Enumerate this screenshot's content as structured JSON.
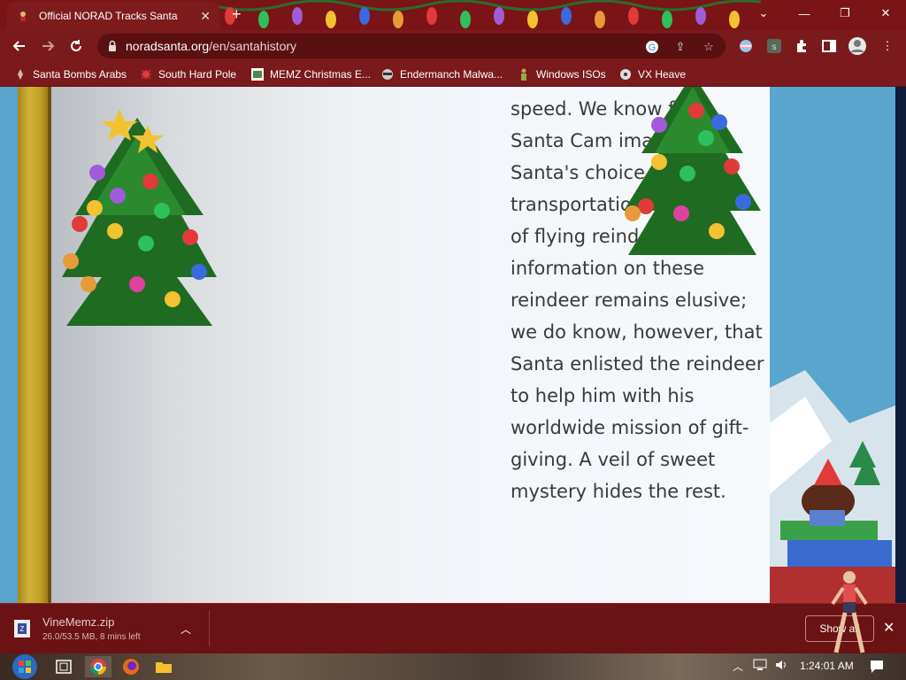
{
  "browser": {
    "tab_title": "Official NORAD Tracks Santa",
    "new_tab": "+",
    "url_host": "noradsanta.org",
    "url_path": "/en/santahistory",
    "window_controls": {
      "dropdown": "⌄",
      "minimize": "—",
      "restore": "❐",
      "close": "✕"
    }
  },
  "bookmarks": [
    {
      "label": "Santa Bombs Arabs",
      "icon": "rocket-icon"
    },
    {
      "label": "South Hard Pole",
      "icon": "bug-icon"
    },
    {
      "label": "MEMZ Christmas E...",
      "icon": "image-icon"
    },
    {
      "label": "Endermanch Malwa...",
      "icon": "raccoon-icon"
    },
    {
      "label": "Windows ISOs",
      "icon": "figure-icon"
    },
    {
      "label": "VX Heave",
      "icon": "hazard-icon"
    }
  ],
  "story": {
    "lines": [
      "speed. We know from",
      "Santa Cam images th",
      "Santa's choice for",
      "transportation wa",
      "of flying reindeer.",
      "information on these",
      "reindeer remains elusive;",
      "we do know, however, that",
      "Santa enlisted the reindeer",
      "to help him with his",
      "worldwide mission of gift-",
      "giving. A veil of sweet",
      "mystery hides the rest."
    ]
  },
  "downloads": {
    "file_name": "VineMemz.zip",
    "status": "26.0/53.5 MB, 8 mins left",
    "show_all": "Show all",
    "close": "✕"
  },
  "taskbar": {
    "clock": "1:24:01 AM"
  },
  "colors": {
    "chrome_frame": "#7a1416",
    "download_bar": "#6b1214",
    "page_bg": "#f3f6fa",
    "gold_border": "#c29f24"
  }
}
